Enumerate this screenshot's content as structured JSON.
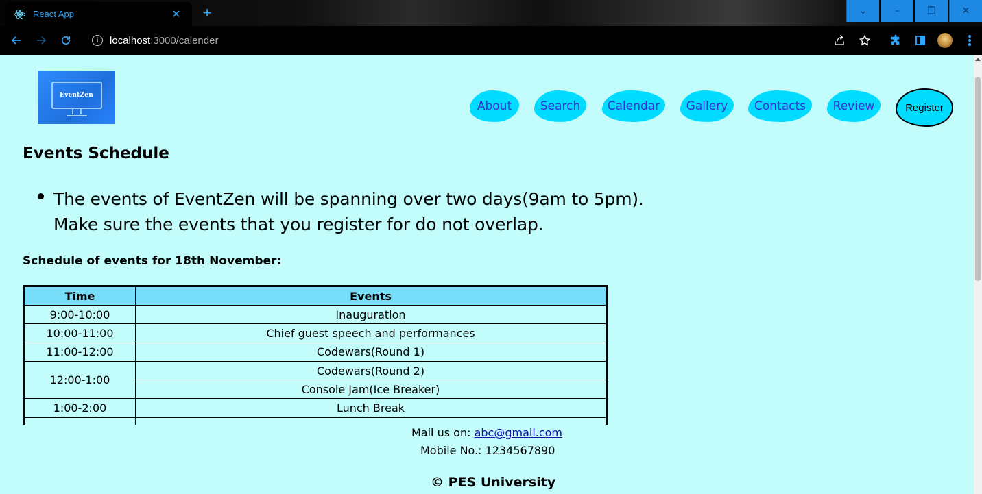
{
  "browser": {
    "tab_title": "React App",
    "tab_close": "✕",
    "new_tab": "+",
    "url_host": "localhost",
    "url_rest": ":3000/calender",
    "window_controls": {
      "dropdown": "⌄",
      "minimize": "–",
      "restore": "❐",
      "close": "✕"
    },
    "accent_color": "#2ea7ff"
  },
  "header": {
    "logo_text": "EventZen",
    "nav": {
      "about": "About",
      "search": "Search",
      "calendar": "Calendar",
      "gallery": "Gallery",
      "contacts": "Contacts",
      "review": "Review",
      "register": "Register"
    },
    "pill_color": "#00dbff"
  },
  "main": {
    "title": "Events Schedule",
    "intro": "The events of EventZen will be spanning over two days(9am to 5pm). Make sure the events that you register for do not overlap.",
    "schedule_title": "Schedule of events for 18th November:",
    "table": {
      "headers": [
        "Time",
        "Events"
      ],
      "rows": [
        {
          "time": "9:00-10:00",
          "event": "Inauguration"
        },
        {
          "time": "10:00-11:00",
          "event": "Chief guest speech and performances"
        },
        {
          "time": "11:00-12:00",
          "event": "Codewars(Round 1)"
        },
        {
          "time": "12:00-1:00",
          "event": "Codewars(Round 2)",
          "event2": "Console Jam(Ice Breaker)"
        },
        {
          "time": "1:00-2:00",
          "event": "Lunch Break"
        }
      ],
      "header_bg": "#77ddf8"
    }
  },
  "footer": {
    "mail_label": "Mail us on: ",
    "mail_link": "abc@gmail.com",
    "mobile": "Mobile No.: 1234567890",
    "copyright": "© PES University"
  },
  "page_background": "#c2fdfc"
}
